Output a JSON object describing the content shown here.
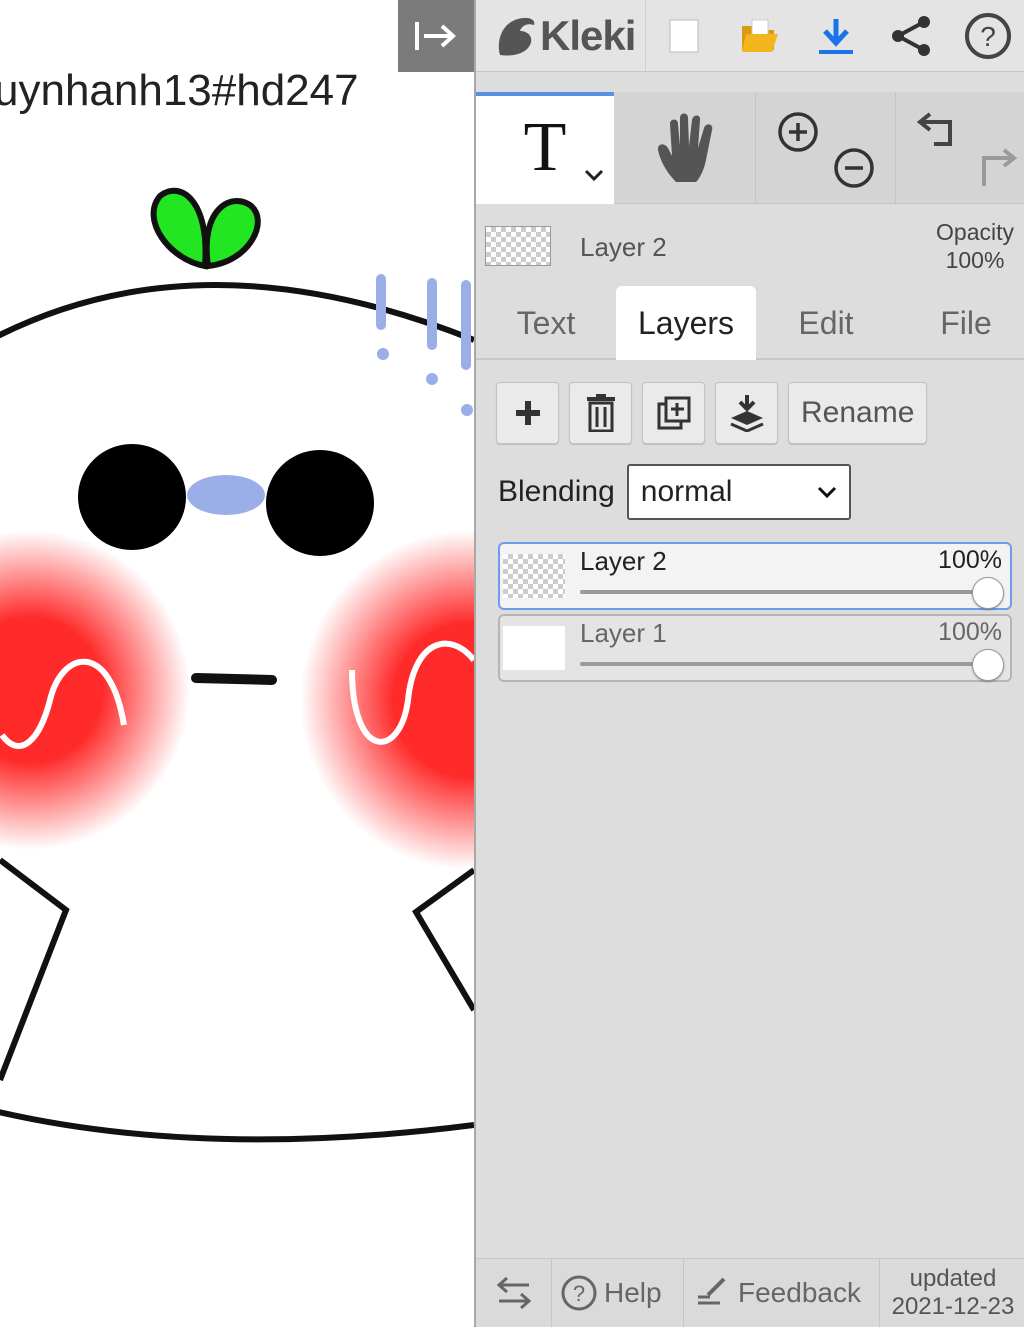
{
  "canvas": {
    "text": "uynhanh13#hd247"
  },
  "app": {
    "name": "Kleki"
  },
  "topbar": {
    "icons": [
      "new-image-icon",
      "open-folder-icon",
      "download-icon",
      "share-icon",
      "help-icon"
    ]
  },
  "tools": {
    "active": "text",
    "text_glyph": "T",
    "icons": [
      "hand-icon",
      "zoom-in-icon",
      "zoom-out-icon",
      "undo-icon",
      "redo-icon"
    ]
  },
  "layer_info": {
    "name": "Layer 2",
    "opacity_label": "Opacity",
    "opacity_value": "100%"
  },
  "tabs": [
    {
      "label": "Text"
    },
    {
      "label": "Layers",
      "active": true
    },
    {
      "label": "Edit"
    },
    {
      "label": "File"
    }
  ],
  "layer_actions": {
    "rename_label": "Rename"
  },
  "blending": {
    "label": "Blending",
    "value": "normal"
  },
  "layers": [
    {
      "name": "Layer 2",
      "opacity": "100%",
      "selected": true
    },
    {
      "name": "Layer 1",
      "opacity": "100%",
      "selected": false
    }
  ],
  "bottombar": {
    "help_label": "Help",
    "feedback_label": "Feedback",
    "updated_label": "updated",
    "updated_date": "2021-12-23"
  },
  "colors": {
    "accent": "#5a90e0",
    "sidebar_bg": "#dddddd",
    "download_blue": "#1a73e8",
    "folder_yellow": "#f3b61f",
    "sprout_green": "#22e622",
    "blush_red": "#ff2a2a",
    "nose_blue": "#9aaee8"
  }
}
